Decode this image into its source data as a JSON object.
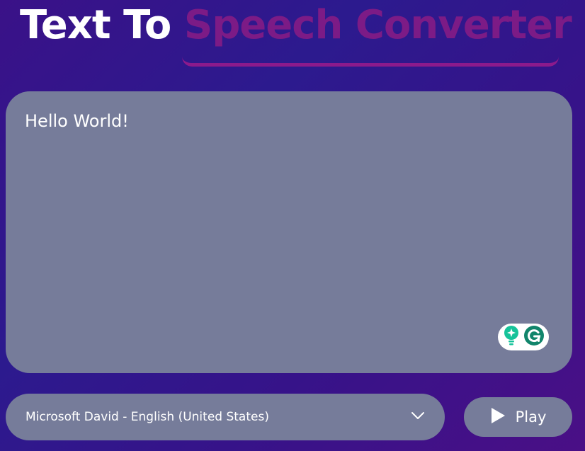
{
  "header": {
    "title_part1": "Text To",
    "title_part2": "Speech Converter"
  },
  "editor": {
    "value": "Hello World!"
  },
  "voice_select": {
    "selected": "Microsoft David - English (United States)"
  },
  "play_button": {
    "label": "Play"
  },
  "colors": {
    "title_accent": "#7c1b86",
    "panel": "#767c9a",
    "grammarly_green": "#15c39a",
    "grammarly_dark": "#11856b"
  }
}
